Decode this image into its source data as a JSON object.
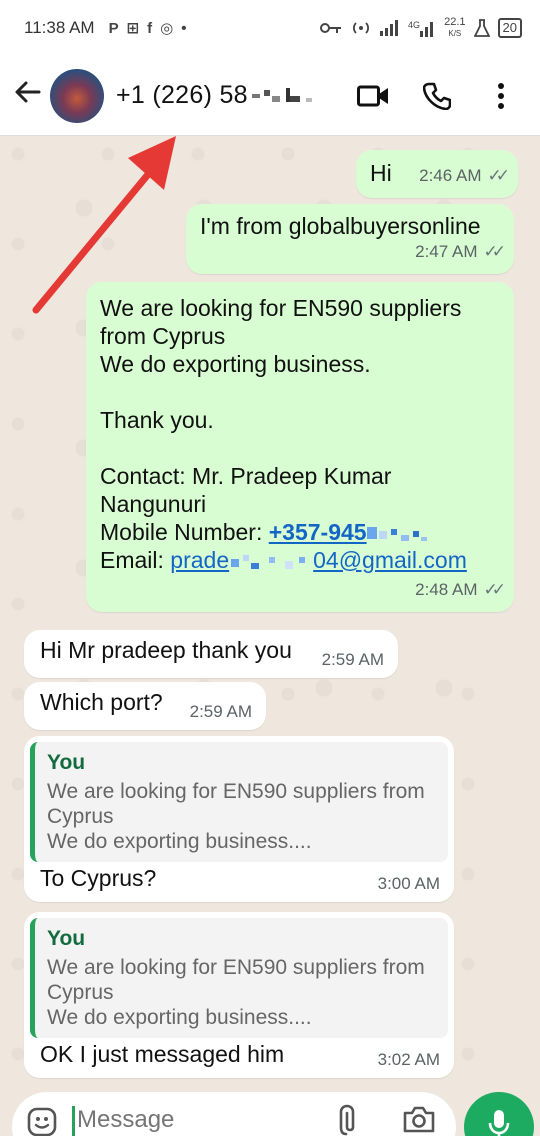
{
  "status_bar": {
    "time": "11:38 AM",
    "left_icons": [
      "P",
      "⊞",
      "f",
      "◎",
      "•"
    ],
    "net_speed": "22.1",
    "net_unit": "K/S",
    "battery": "20"
  },
  "header": {
    "contact_name": "+1 (226) 58",
    "back_icon": "arrow-left-icon",
    "actions": [
      "video-call-icon",
      "voice-call-icon",
      "more-options-icon"
    ]
  },
  "messages": [
    {
      "dir": "out",
      "text": "Hi",
      "time": "2:46 AM"
    },
    {
      "dir": "out",
      "text": "I'm from globalbuyersonline",
      "time": "2:47 AM"
    },
    {
      "dir": "out",
      "lines": [
        "We are looking for EN590 suppliers",
        "from Cyprus",
        "We do exporting business.",
        "Thank you.",
        "Contact: Mr. Pradeep Kumar",
        "Nangunuri"
      ],
      "mobile_label": "Mobile Number: ",
      "mobile_value": "+357-945",
      "email_label": "Email: ",
      "email_value_start": "prade",
      "email_value_end": "04@gmail.com",
      "time": "2:48 AM"
    },
    {
      "dir": "in",
      "text": "Hi Mr pradeep thank you",
      "time": "2:59 AM"
    },
    {
      "dir": "in",
      "text": "Which port?",
      "time": "2:59 AM"
    },
    {
      "dir": "in",
      "quote_name": "You",
      "quote_line1": "We are looking for EN590 suppliers from",
      "quote_line2": "Cyprus",
      "quote_line3": "We do exporting business....",
      "text": "To Cyprus?",
      "time": "3:00 AM"
    },
    {
      "dir": "in",
      "quote_name": "You",
      "quote_line1": "We are looking for EN590 suppliers from",
      "quote_line2": "Cyprus",
      "quote_line3": "We do exporting business....",
      "text": "OK I just messaged him",
      "time": "3:02 AM"
    }
  ],
  "composer": {
    "placeholder": "Message"
  },
  "colors": {
    "outgoing_bubble": "#d9fdd3",
    "incoming_bubble": "#ffffff",
    "accent_green": "#1daa61",
    "annotation_arrow": "#e53935"
  }
}
